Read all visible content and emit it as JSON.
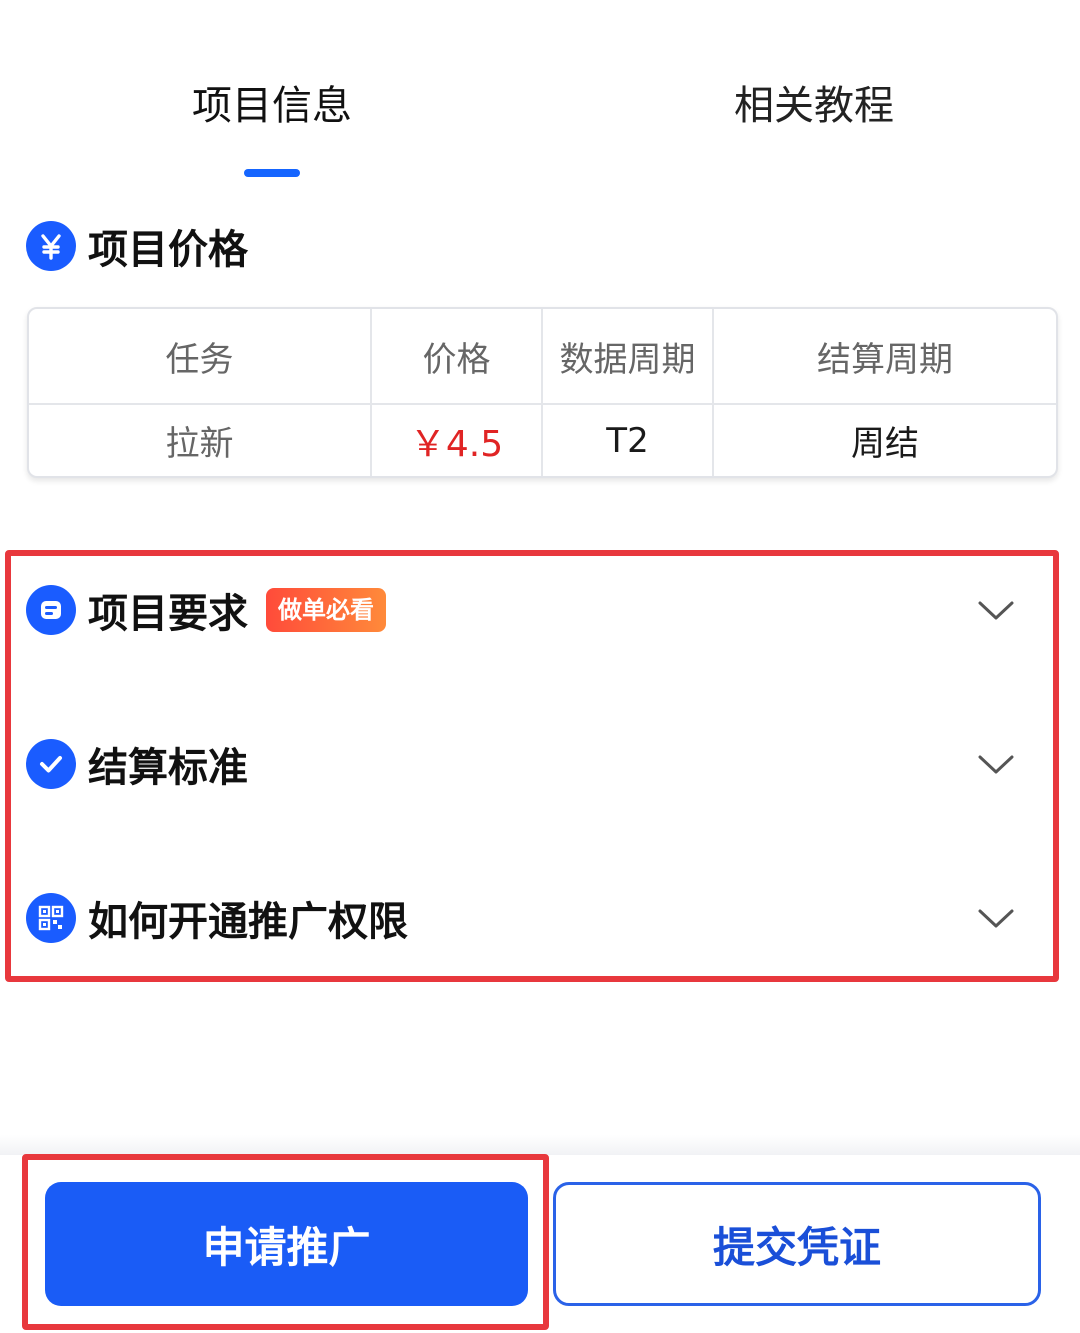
{
  "tabs": [
    {
      "label": "项目信息",
      "active": true
    },
    {
      "label": "相关教程",
      "active": false
    }
  ],
  "price_section": {
    "icon": "yen-icon",
    "title": "项目价格"
  },
  "price_table": {
    "headers": [
      "任务",
      "价格",
      "数据周期",
      "结算周期"
    ],
    "rows": [
      [
        "拉新",
        "￥4.5",
        "T2",
        "周结"
      ]
    ]
  },
  "sections": [
    {
      "icon": "list-icon",
      "title": "项目要求",
      "badge": "做单必看"
    },
    {
      "icon": "check-icon",
      "title": "结算标准"
    },
    {
      "icon": "qr-icon",
      "title": "如何开通推广权限"
    }
  ],
  "buttons": {
    "apply": "申请推广",
    "submit": "提交凭证"
  },
  "colors": {
    "accent": "#1a5cf6",
    "highlight_frame": "#e8383d",
    "price": "#e02424"
  }
}
